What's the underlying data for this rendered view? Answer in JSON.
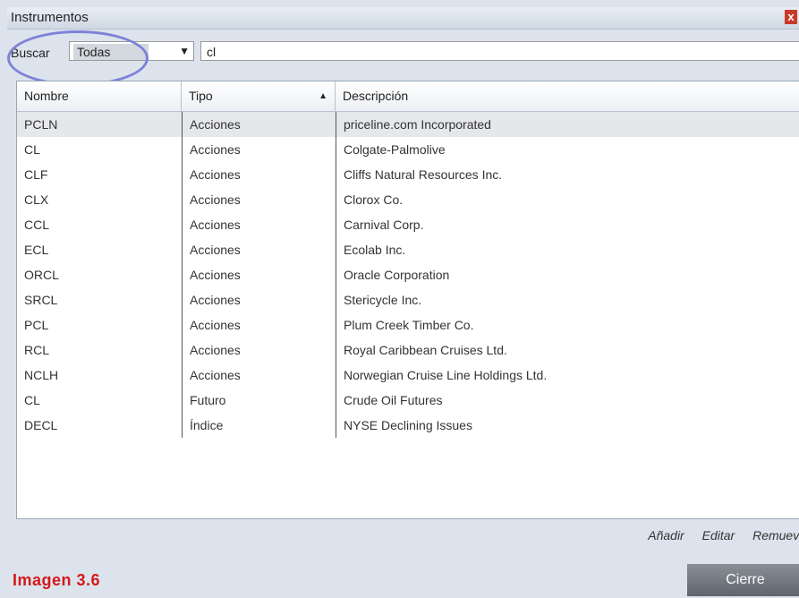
{
  "window": {
    "title": "Instrumentos",
    "close_glyph": "x"
  },
  "search": {
    "label": "Buscar",
    "filter_value": "Todas",
    "query_value": "cl"
  },
  "table": {
    "columns": [
      "Nombre",
      "Tipo",
      "Descripción"
    ],
    "rows": [
      [
        "PCLN",
        "Acciones",
        "priceline.com Incorporated"
      ],
      [
        "CL",
        "Acciones",
        "Colgate-Palmolive"
      ],
      [
        "CLF",
        "Acciones",
        "Cliffs Natural Resources Inc."
      ],
      [
        "CLX",
        "Acciones",
        "Clorox Co."
      ],
      [
        "CCL",
        "Acciones",
        "Carnival Corp."
      ],
      [
        "ECL",
        "Acciones",
        "Ecolab Inc."
      ],
      [
        "ORCL",
        "Acciones",
        "Oracle Corporation"
      ],
      [
        "SRCL",
        "Acciones",
        "Stericycle Inc."
      ],
      [
        "PCL",
        "Acciones",
        "Plum Creek Timber Co."
      ],
      [
        "RCL",
        "Acciones",
        "Royal Caribbean Cruises Ltd."
      ],
      [
        "NCLH",
        "Acciones",
        "Norwegian Cruise Line Holdings Ltd."
      ],
      [
        "CL",
        "Futuro",
        "Crude Oil Futures"
      ],
      [
        "DECL",
        "Índice",
        "NYSE Declining Issues"
      ]
    ]
  },
  "actions": {
    "add": "Añadir",
    "edit": "Editar",
    "remove": "Remueva"
  },
  "caption": "Imagen 3.6",
  "close_button": "Cierre",
  "colors": {
    "caption": "#d21a1a",
    "highlight": "#7d82d8",
    "selected_row": "#e5e7ea"
  }
}
